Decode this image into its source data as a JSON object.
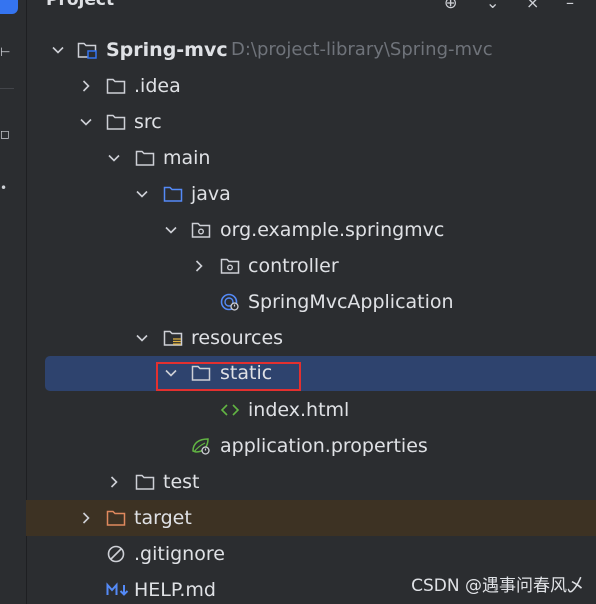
{
  "panel": {
    "title": "Project"
  },
  "tree": [
    {
      "label": "Spring-mvc",
      "path": "D:\\project-library\\Spring-mvc",
      "icon": "module-folder-icon",
      "expanded": true,
      "color": "#dfe1e5"
    },
    {
      "label": ".idea",
      "icon": "folder-icon",
      "expanded": false,
      "color": "#e0895e"
    },
    {
      "label": "src",
      "icon": "folder-icon",
      "expanded": true,
      "color": "#dfe1e5"
    },
    {
      "label": "main",
      "icon": "folder-icon",
      "expanded": true,
      "color": "#dfe1e5"
    },
    {
      "label": "java",
      "icon": "source-folder-icon",
      "expanded": true,
      "color": "#dfe1e5"
    },
    {
      "label": "org.example.springmvc",
      "icon": "package-icon",
      "expanded": true,
      "color": "#dfe1e5"
    },
    {
      "label": "controller",
      "icon": "package-icon",
      "expanded": false,
      "color": "#dfe1e5"
    },
    {
      "label": "SpringMvcApplication",
      "icon": "spring-boot-class-icon",
      "color": "#ef7c70"
    },
    {
      "label": "resources",
      "icon": "resources-folder-icon",
      "expanded": true,
      "color": "#dfe1e5"
    },
    {
      "label": "static",
      "icon": "folder-icon",
      "expanded": true,
      "selected": true,
      "color": "#dfe1e5"
    },
    {
      "label": "index.html",
      "icon": "html-file-icon",
      "color": "#62b543"
    },
    {
      "label": "application.properties",
      "icon": "spring-properties-icon",
      "color": "#e0895e"
    },
    {
      "label": "test",
      "icon": "folder-icon",
      "expanded": false,
      "color": "#dfe1e5"
    },
    {
      "label": "target",
      "icon": "excluded-folder-icon",
      "expanded": false,
      "excluded": true,
      "color": "#e0895e"
    },
    {
      "label": ".gitignore",
      "icon": "gitignore-icon",
      "color": "#cc7f5a"
    },
    {
      "label": "HELP.md",
      "icon": "markdown-icon",
      "color": "#e0895e"
    }
  ],
  "watermark": "CSDN @遇事问春风乄"
}
